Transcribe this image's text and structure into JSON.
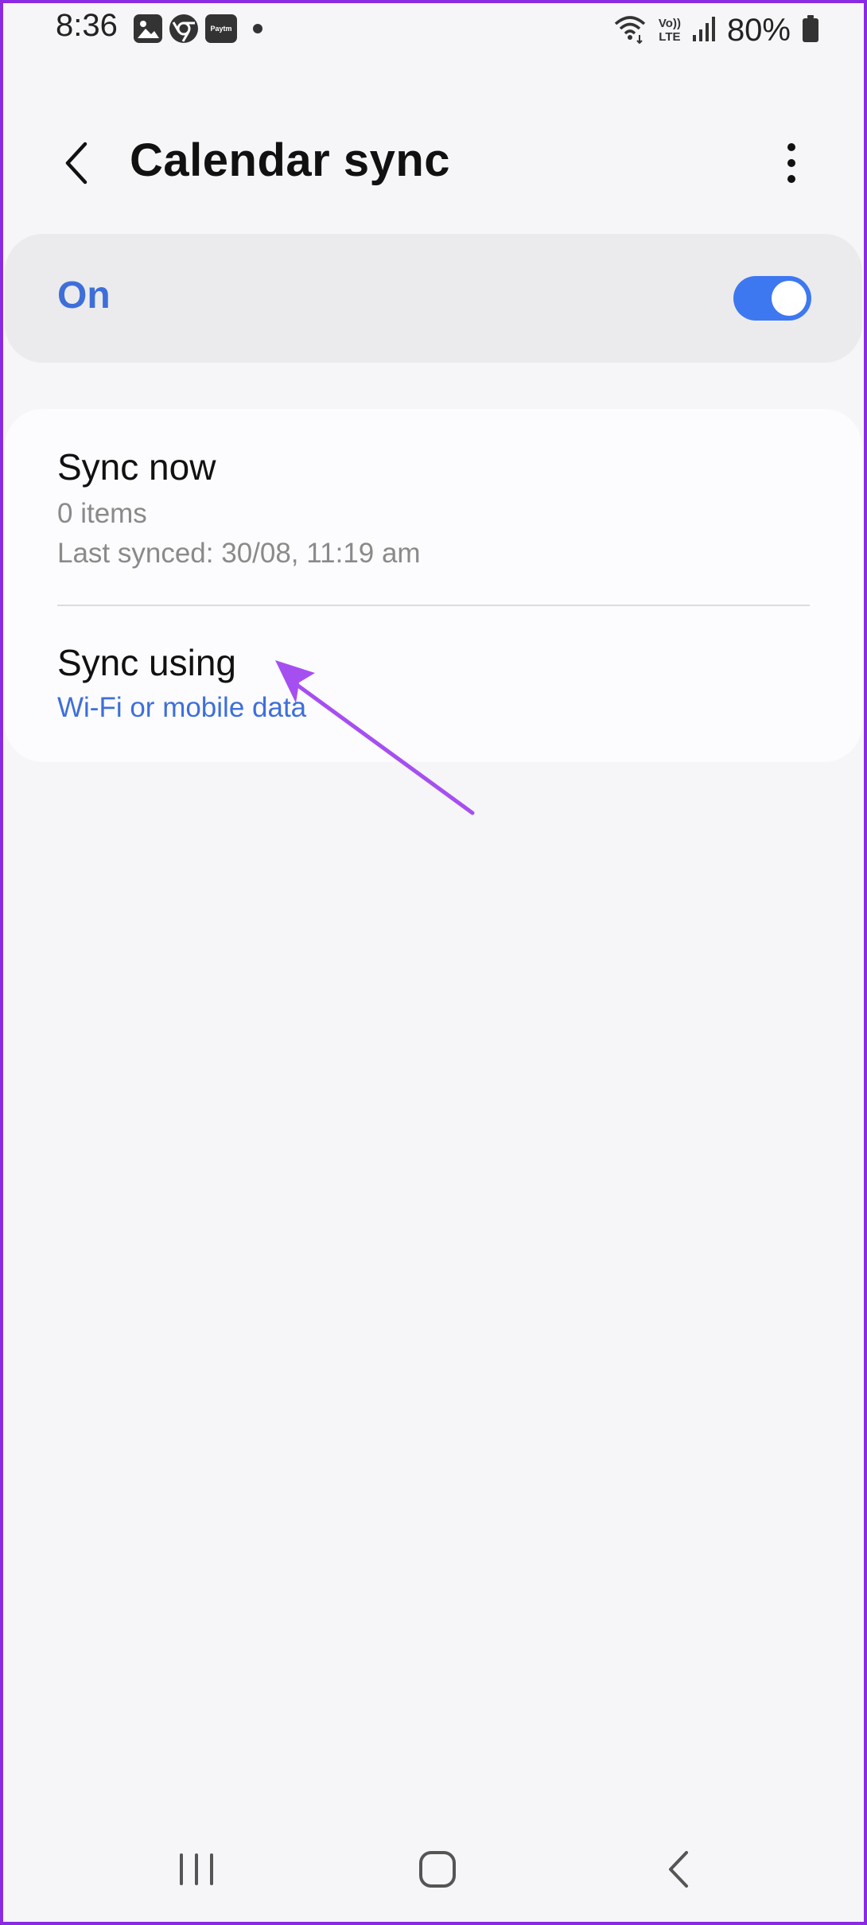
{
  "status_bar": {
    "time": "8:36",
    "left_icons": [
      "gallery-icon",
      "chrome-icon",
      "paytm-icon",
      "notification-dot"
    ],
    "paytm_label": "Paytm",
    "volte_top": "Vo))",
    "volte_bottom": "LTE",
    "battery": "80%",
    "right_icons": [
      "wifi-icon",
      "volte-icon",
      "signal-icon",
      "battery-icon"
    ]
  },
  "header": {
    "title": "Calendar sync",
    "back_icon": "chevron-left-icon",
    "more_icon": "more-vertical-icon"
  },
  "master_toggle": {
    "label": "On",
    "state": true
  },
  "settings": {
    "sync_now": {
      "title": "Sync now",
      "items": "0 items",
      "last_synced": "Last synced: 30/08, 11:19 am"
    },
    "sync_using": {
      "title": "Sync using",
      "value": "Wi-Fi or mobile data"
    }
  },
  "nav_bar": {
    "icons": [
      "recent-apps-icon",
      "home-icon",
      "back-icon"
    ]
  },
  "colors": {
    "accent": "#3e6fd9",
    "switch_on": "#3e78f0",
    "annotation_arrow": "#a64ff0",
    "frame_border": "#8a2be2",
    "background": "#f6f6f8"
  }
}
